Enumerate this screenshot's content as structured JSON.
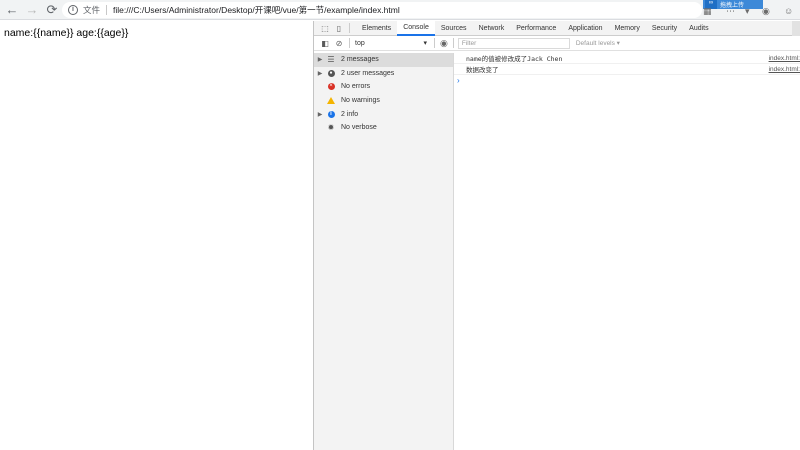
{
  "browser": {
    "scheme_label": "文件",
    "url": "file:///C:/Users/Administrator/Desktop/开课吧/vue/第一节/example/index.html",
    "extension_badge": "拖拽上传"
  },
  "page": {
    "text": "name:{{name}} age:{{age}}"
  },
  "devtools": {
    "tabs": [
      "Elements",
      "Console",
      "Sources",
      "Network",
      "Performance",
      "Application",
      "Memory",
      "Security",
      "Audits"
    ],
    "active_tab": "Console",
    "context": "top",
    "filter_placeholder": "Filter",
    "levels_label": "Default levels ▾",
    "sidebar": [
      {
        "label": "2 messages",
        "icon": "list-icon",
        "expandable": true,
        "selected": true
      },
      {
        "label": "2 user messages",
        "icon": "user-icon",
        "expandable": true,
        "selected": false
      },
      {
        "label": "No errors",
        "icon": "error-icon",
        "expandable": false,
        "selected": false
      },
      {
        "label": "No warnings",
        "icon": "warning-icon",
        "expandable": false,
        "selected": false
      },
      {
        "label": "2 info",
        "icon": "info-icon",
        "expandable": true,
        "selected": false
      },
      {
        "label": "No verbose",
        "icon": "gear-icon",
        "expandable": false,
        "selected": false
      }
    ],
    "console_lines": [
      {
        "message": "name的值被修改成了Jack Chen",
        "source": "index.html:"
      },
      {
        "message": "数据改变了",
        "source": "index.html:"
      }
    ]
  },
  "colors": {
    "accent": "#1a73e8",
    "error": "#d93025",
    "warning": "#f4b400"
  }
}
